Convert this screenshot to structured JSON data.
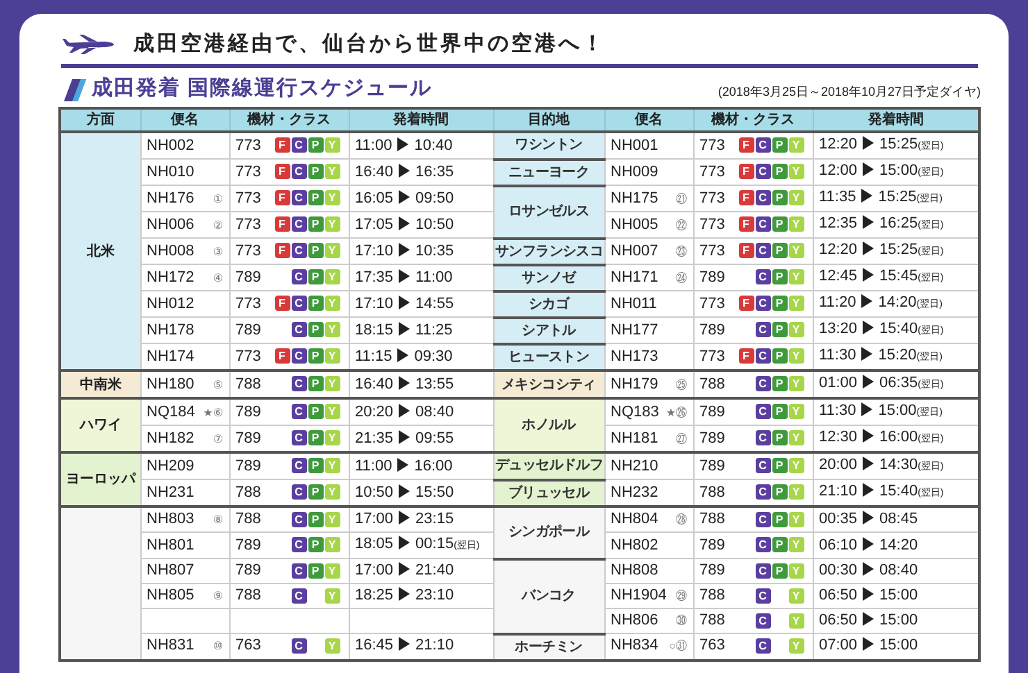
{
  "header": {
    "title": "成田空港経由で、仙台から世界中の空港へ！"
  },
  "section": {
    "title": "成田発着 国際線運行スケジュール",
    "period": "(2018年3月25日～2018年10月27日予定ダイヤ)"
  },
  "table": {
    "columns": [
      "方面",
      "便名",
      "機材・クラス",
      "発着時間",
      "目的地",
      "便名",
      "機材・クラス",
      "発着時間"
    ],
    "groups": [
      {
        "region": "北米",
        "color": "#d5eef5",
        "flights": [
          {
            "flight": "NH002",
            "aircraft": "773",
            "classes": [
              {
                "kind": "first",
                "label": "F"
              },
              {
                "kind": "business",
                "label": "C"
              },
              {
                "kind": "premium",
                "label": "P"
              },
              {
                "kind": "economy",
                "label": "Y"
              }
            ],
            "dep": "11:00",
            "arr": "10:40"
          },
          {
            "flight": "NH010",
            "aircraft": "773",
            "classes": [
              {
                "kind": "first",
                "label": "F"
              },
              {
                "kind": "business",
                "label": "C"
              },
              {
                "kind": "premium",
                "label": "P"
              },
              {
                "kind": "economy",
                "label": "Y"
              }
            ],
            "dep": "16:40",
            "arr": "16:35"
          },
          {
            "flight": "NH176",
            "note": "①",
            "aircraft": "773",
            "classes": [
              {
                "kind": "first",
                "label": "F"
              },
              {
                "kind": "business",
                "label": "C"
              },
              {
                "kind": "premium",
                "label": "P"
              },
              {
                "kind": "economy",
                "label": "Y"
              }
            ],
            "dep": "16:05",
            "arr": "09:50"
          },
          {
            "flight": "NH006",
            "note": "②",
            "aircraft": "773",
            "classes": [
              {
                "kind": "first",
                "label": "F"
              },
              {
                "kind": "business",
                "label": "C"
              },
              {
                "kind": "premium",
                "label": "P"
              },
              {
                "kind": "economy",
                "label": "Y"
              }
            ],
            "dep": "17:05",
            "arr": "10:50"
          },
          {
            "flight": "NH008",
            "note": "③",
            "aircraft": "773",
            "classes": [
              {
                "kind": "first",
                "label": "F"
              },
              {
                "kind": "business",
                "label": "C"
              },
              {
                "kind": "premium",
                "label": "P"
              },
              {
                "kind": "economy",
                "label": "Y"
              }
            ],
            "dep": "17:10",
            "arr": "10:35"
          },
          {
            "flight": "NH172",
            "note": "④",
            "aircraft": "789",
            "classes": [
              {
                "kind": "business",
                "label": "C"
              },
              {
                "kind": "premium",
                "label": "P"
              },
              {
                "kind": "economy",
                "label": "Y"
              }
            ],
            "dep": "17:35",
            "arr": "11:00"
          },
          {
            "flight": "NH012",
            "aircraft": "773",
            "classes": [
              {
                "kind": "first",
                "label": "F"
              },
              {
                "kind": "business",
                "label": "C"
              },
              {
                "kind": "premium",
                "label": "P"
              },
              {
                "kind": "economy",
                "label": "Y"
              }
            ],
            "dep": "17:10",
            "arr": "14:55"
          },
          {
            "flight": "NH178",
            "aircraft": "789",
            "classes": [
              {
                "kind": "business",
                "label": "C"
              },
              {
                "kind": "premium",
                "label": "P"
              },
              {
                "kind": "economy",
                "label": "Y"
              }
            ],
            "dep": "18:15",
            "arr": "11:25"
          },
          {
            "flight": "NH174",
            "aircraft": "773",
            "classes": [
              {
                "kind": "first",
                "label": "F"
              },
              {
                "kind": "business",
                "label": "C"
              },
              {
                "kind": "premium",
                "label": "P"
              },
              {
                "kind": "economy",
                "label": "Y"
              }
            ],
            "dep": "11:15",
            "arr": "09:30"
          }
        ],
        "destinations": [
          {
            "name": "ワシントン",
            "flights": [
              {
                "flight": "NH001",
                "aircraft": "773",
                "classes": [
                  {
                    "kind": "first",
                    "label": "F"
                  },
                  {
                    "kind": "business",
                    "label": "C"
                  },
                  {
                    "kind": "premium",
                    "label": "P"
                  },
                  {
                    "kind": "economy",
                    "label": "Y"
                  }
                ],
                "dep": "12:20",
                "arr": "15:25",
                "next_day": "(翌日)"
              }
            ]
          },
          {
            "name": "ニューヨーク",
            "flights": [
              {
                "flight": "NH009",
                "aircraft": "773",
                "classes": [
                  {
                    "kind": "first",
                    "label": "F"
                  },
                  {
                    "kind": "business",
                    "label": "C"
                  },
                  {
                    "kind": "premium",
                    "label": "P"
                  },
                  {
                    "kind": "economy",
                    "label": "Y"
                  }
                ],
                "dep": "12:00",
                "arr": "15:00",
                "next_day": "(翌日)"
              }
            ]
          },
          {
            "name": "ロサンゼルス",
            "flights": [
              {
                "flight": "NH175",
                "note": "㉑",
                "aircraft": "773",
                "classes": [
                  {
                    "kind": "first",
                    "label": "F"
                  },
                  {
                    "kind": "business",
                    "label": "C"
                  },
                  {
                    "kind": "premium",
                    "label": "P"
                  },
                  {
                    "kind": "economy",
                    "label": "Y"
                  }
                ],
                "dep": "11:35",
                "arr": "15:25",
                "next_day": "(翌日)"
              },
              {
                "flight": "NH005",
                "note": "㉒",
                "aircraft": "773",
                "classes": [
                  {
                    "kind": "first",
                    "label": "F"
                  },
                  {
                    "kind": "business",
                    "label": "C"
                  },
                  {
                    "kind": "premium",
                    "label": "P"
                  },
                  {
                    "kind": "economy",
                    "label": "Y"
                  }
                ],
                "dep": "12:35",
                "arr": "16:25",
                "next_day": "(翌日)"
              }
            ]
          },
          {
            "name": "サンフランシスコ",
            "flights": [
              {
                "flight": "NH007",
                "note": "㉓",
                "aircraft": "773",
                "classes": [
                  {
                    "kind": "first",
                    "label": "F"
                  },
                  {
                    "kind": "business",
                    "label": "C"
                  },
                  {
                    "kind": "premium",
                    "label": "P"
                  },
                  {
                    "kind": "economy",
                    "label": "Y"
                  }
                ],
                "dep": "12:20",
                "arr": "15:25",
                "next_day": "(翌日)"
              }
            ]
          },
          {
            "name": "サンノゼ",
            "flights": [
              {
                "flight": "NH171",
                "note": "㉔",
                "aircraft": "789",
                "classes": [
                  {
                    "kind": "business",
                    "label": "C"
                  },
                  {
                    "kind": "premium",
                    "label": "P"
                  },
                  {
                    "kind": "economy",
                    "label": "Y"
                  }
                ],
                "dep": "12:45",
                "arr": "15:45",
                "next_day": "(翌日)"
              }
            ]
          },
          {
            "name": "シカゴ",
            "flights": [
              {
                "flight": "NH011",
                "aircraft": "773",
                "classes": [
                  {
                    "kind": "first",
                    "label": "F"
                  },
                  {
                    "kind": "business",
                    "label": "C"
                  },
                  {
                    "kind": "premium",
                    "label": "P"
                  },
                  {
                    "kind": "economy",
                    "label": "Y"
                  }
                ],
                "dep": "11:20",
                "arr": "14:20",
                "next_day": "(翌日)"
              }
            ]
          },
          {
            "name": "シアトル",
            "flights": [
              {
                "flight": "NH177",
                "aircraft": "789",
                "classes": [
                  {
                    "kind": "business",
                    "label": "C"
                  },
                  {
                    "kind": "premium",
                    "label": "P"
                  },
                  {
                    "kind": "economy",
                    "label": "Y"
                  }
                ],
                "dep": "13:20",
                "arr": "15:40",
                "next_day": "(翌日)"
              }
            ]
          },
          {
            "name": "ヒューストン",
            "flights": [
              {
                "flight": "NH173",
                "aircraft": "773",
                "classes": [
                  {
                    "kind": "first",
                    "label": "F"
                  },
                  {
                    "kind": "business",
                    "label": "C"
                  },
                  {
                    "kind": "premium",
                    "label": "P"
                  },
                  {
                    "kind": "economy",
                    "label": "Y"
                  }
                ],
                "dep": "11:30",
                "arr": "15:20",
                "next_day": "(翌日)"
              }
            ]
          }
        ]
      },
      {
        "region": "中南米",
        "color": "#f5ead3",
        "flights": [
          {
            "flight": "NH180",
            "note": "⑤",
            "aircraft": "788",
            "classes": [
              {
                "kind": "business",
                "label": "C"
              },
              {
                "kind": "premium",
                "label": "P"
              },
              {
                "kind": "economy",
                "label": "Y"
              }
            ],
            "dep": "16:40",
            "arr": "13:55"
          }
        ],
        "destinations": [
          {
            "name": "メキシコシティ",
            "flights": [
              {
                "flight": "NH179",
                "note": "㉕",
                "aircraft": "788",
                "classes": [
                  {
                    "kind": "business",
                    "label": "C"
                  },
                  {
                    "kind": "premium",
                    "label": "P"
                  },
                  {
                    "kind": "economy",
                    "label": "Y"
                  }
                ],
                "dep": "01:00",
                "arr": "06:35",
                "next_day": "(翌日)"
              }
            ]
          }
        ]
      },
      {
        "region": "ハワイ",
        "color": "#eef6d8",
        "flights": [
          {
            "flight": "NQ184",
            "note": "★⑥",
            "aircraft": "789",
            "classes": [
              {
                "kind": "business",
                "label": "C"
              },
              {
                "kind": "premium",
                "label": "P"
              },
              {
                "kind": "economy",
                "label": "Y"
              }
            ],
            "dep": "20:20",
            "arr": "08:40"
          },
          {
            "flight": "NH182",
            "note": "⑦",
            "aircraft": "789",
            "classes": [
              {
                "kind": "business",
                "label": "C"
              },
              {
                "kind": "premium",
                "label": "P"
              },
              {
                "kind": "economy",
                "label": "Y"
              }
            ],
            "dep": "21:35",
            "arr": "09:55"
          }
        ],
        "destinations": [
          {
            "name": "ホノルル",
            "flights": [
              {
                "flight": "NQ183",
                "note": "★㉖",
                "aircraft": "789",
                "classes": [
                  {
                    "kind": "business",
                    "label": "C"
                  },
                  {
                    "kind": "premium",
                    "label": "P"
                  },
                  {
                    "kind": "economy",
                    "label": "Y"
                  }
                ],
                "dep": "11:30",
                "arr": "15:00",
                "next_day": "(翌日)"
              },
              {
                "flight": "NH181",
                "note": "㉗",
                "aircraft": "789",
                "classes": [
                  {
                    "kind": "business",
                    "label": "C"
                  },
                  {
                    "kind": "premium",
                    "label": "P"
                  },
                  {
                    "kind": "economy",
                    "label": "Y"
                  }
                ],
                "dep": "12:30",
                "arr": "16:00",
                "next_day": "(翌日)"
              }
            ]
          }
        ]
      },
      {
        "region": "ヨーロッパ",
        "color": "#e3f2cf",
        "flights": [
          {
            "flight": "NH209",
            "aircraft": "789",
            "classes": [
              {
                "kind": "business",
                "label": "C"
              },
              {
                "kind": "premium",
                "label": "P"
              },
              {
                "kind": "economy",
                "label": "Y"
              }
            ],
            "dep": "11:00",
            "arr": "16:00"
          },
          {
            "flight": "NH231",
            "aircraft": "788",
            "classes": [
              {
                "kind": "business",
                "label": "C"
              },
              {
                "kind": "premium",
                "label": "P"
              },
              {
                "kind": "economy",
                "label": "Y"
              }
            ],
            "dep": "10:50",
            "arr": "15:50"
          }
        ],
        "destinations": [
          {
            "name": "デュッセルドルフ",
            "flights": [
              {
                "flight": "NH210",
                "aircraft": "789",
                "classes": [
                  {
                    "kind": "business",
                    "label": "C"
                  },
                  {
                    "kind": "premium",
                    "label": "P"
                  },
                  {
                    "kind": "economy",
                    "label": "Y"
                  }
                ],
                "dep": "20:00",
                "arr": "14:30",
                "next_day": "(翌日)"
              }
            ]
          },
          {
            "name": "ブリュッセル",
            "flights": [
              {
                "flight": "NH232",
                "aircraft": "788",
                "classes": [
                  {
                    "kind": "business",
                    "label": "C"
                  },
                  {
                    "kind": "premium",
                    "label": "P"
                  },
                  {
                    "kind": "economy",
                    "label": "Y"
                  }
                ],
                "dep": "21:10",
                "arr": "15:40",
                "next_day": "(翌日)"
              }
            ]
          }
        ]
      },
      {
        "color": "#f6f6f6",
        "flights": [
          {
            "flight": "NH803",
            "note": "⑧",
            "aircraft": "788",
            "classes": [
              {
                "kind": "business",
                "label": "C"
              },
              {
                "kind": "premium",
                "label": "P"
              },
              {
                "kind": "economy",
                "label": "Y"
              }
            ],
            "dep": "17:00",
            "arr": "23:15"
          },
          {
            "flight": "NH801",
            "aircraft": "789",
            "classes": [
              {
                "kind": "business",
                "label": "C"
              },
              {
                "kind": "premium",
                "label": "P"
              },
              {
                "kind": "economy",
                "label": "Y"
              }
            ],
            "dep": "18:05",
            "arr": "00:15",
            "next_day": "(翌日)"
          },
          {
            "flight": "NH807",
            "aircraft": "789",
            "classes": [
              {
                "kind": "business",
                "label": "C"
              },
              {
                "kind": "premium",
                "label": "P"
              },
              {
                "kind": "economy",
                "label": "Y"
              }
            ],
            "dep": "17:00",
            "arr": "21:40"
          },
          {
            "flight": "NH805",
            "note": "⑨",
            "aircraft": "788",
            "classes": [
              {
                "kind": "business",
                "label": "C"
              },
              {
                "kind": "economy",
                "label": "Y"
              }
            ],
            "dep": "18:25",
            "arr": "23:10"
          },
          {
            "flight": "NH831",
            "note": "⑩",
            "gap_before": true,
            "aircraft": "763",
            "classes": [
              {
                "kind": "business",
                "label": "C"
              },
              {
                "kind": "economy",
                "label": "Y"
              }
            ],
            "dep": "16:45",
            "arr": "21:10"
          }
        ],
        "destinations": [
          {
            "name": "シンガポール",
            "flights": [
              {
                "flight": "NH804",
                "note": "㉘",
                "aircraft": "788",
                "classes": [
                  {
                    "kind": "business",
                    "label": "C"
                  },
                  {
                    "kind": "premium",
                    "label": "P"
                  },
                  {
                    "kind": "economy",
                    "label": "Y"
                  }
                ],
                "dep": "00:35",
                "arr": "08:45"
              },
              {
                "flight": "NH802",
                "aircraft": "789",
                "classes": [
                  {
                    "kind": "business",
                    "label": "C"
                  },
                  {
                    "kind": "premium",
                    "label": "P"
                  },
                  {
                    "kind": "economy",
                    "label": "Y"
                  }
                ],
                "dep": "06:10",
                "arr": "14:20"
              }
            ]
          },
          {
            "name": "バンコク",
            "flights": [
              {
                "flight": "NH808",
                "aircraft": "789",
                "classes": [
                  {
                    "kind": "business",
                    "label": "C"
                  },
                  {
                    "kind": "premium",
                    "label": "P"
                  },
                  {
                    "kind": "economy",
                    "label": "Y"
                  }
                ],
                "dep": "00:30",
                "arr": "08:40"
              },
              {
                "flight": "NH1904",
                "note": "㉙",
                "aircraft": "788",
                "classes": [
                  {
                    "kind": "business",
                    "label": "C"
                  },
                  {
                    "kind": "economy",
                    "label": "Y"
                  }
                ],
                "dep": "06:50",
                "arr": "15:00"
              },
              {
                "flight": "NH806",
                "note": "㉚",
                "aircraft": "788",
                "classes": [
                  {
                    "kind": "business",
                    "label": "C"
                  },
                  {
                    "kind": "economy",
                    "label": "Y"
                  }
                ],
                "dep": "06:50",
                "arr": "15:00"
              }
            ]
          },
          {
            "name": "ホーチミン",
            "flights": [
              {
                "flight": "NH834",
                "note": "○㉛",
                "aircraft": "763",
                "classes": [
                  {
                    "kind": "business",
                    "label": "C"
                  },
                  {
                    "kind": "economy",
                    "label": "Y"
                  }
                ],
                "dep": "07:00",
                "arr": "15:00"
              }
            ]
          }
        ]
      }
    ]
  }
}
